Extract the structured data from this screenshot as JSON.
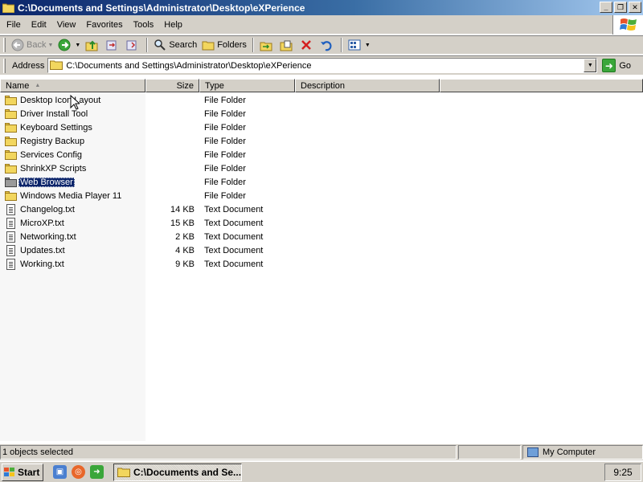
{
  "window": {
    "title": "C:\\Documents and Settings\\Administrator\\Desktop\\eXPerience",
    "minimize_glyph": "_",
    "maximize_glyph": "❐",
    "close_glyph": "✕"
  },
  "menu": {
    "items": [
      {
        "label": "File"
      },
      {
        "label": "Edit"
      },
      {
        "label": "View"
      },
      {
        "label": "Favorites"
      },
      {
        "label": "Tools"
      },
      {
        "label": "Help"
      }
    ]
  },
  "toolbar": {
    "back_label": "Back",
    "search_label": "Search",
    "folders_label": "Folders"
  },
  "address": {
    "label": "Address",
    "value": "C:\\Documents and Settings\\Administrator\\Desktop\\eXPerience",
    "go_label": "Go"
  },
  "columns": {
    "name": "Name",
    "size": "Size",
    "type": "Type",
    "description": "Description"
  },
  "files": [
    {
      "name": "Desktop Icon Layout",
      "size": "",
      "type": "File Folder",
      "kind": "folder",
      "selected": false
    },
    {
      "name": "Driver Install Tool",
      "size": "",
      "type": "File Folder",
      "kind": "folder",
      "selected": false
    },
    {
      "name": "Keyboard Settings",
      "size": "",
      "type": "File Folder",
      "kind": "folder",
      "selected": false
    },
    {
      "name": "Registry Backup",
      "size": "",
      "type": "File Folder",
      "kind": "folder",
      "selected": false
    },
    {
      "name": "Services Config",
      "size": "",
      "type": "File Folder",
      "kind": "folder",
      "selected": false
    },
    {
      "name": "ShrinkXP Scripts",
      "size": "",
      "type": "File Folder",
      "kind": "folder",
      "selected": false
    },
    {
      "name": "Web Browser",
      "size": "",
      "type": "File Folder",
      "kind": "folder",
      "selected": true
    },
    {
      "name": "Windows Media Player 11",
      "size": "",
      "type": "File Folder",
      "kind": "folder",
      "selected": false
    },
    {
      "name": "Changelog.txt",
      "size": "14 KB",
      "type": "Text Document",
      "kind": "text",
      "selected": false
    },
    {
      "name": "MicroXP.txt",
      "size": "15 KB",
      "type": "Text Document",
      "kind": "text",
      "selected": false
    },
    {
      "name": "Networking.txt",
      "size": "2 KB",
      "type": "Text Document",
      "kind": "text",
      "selected": false
    },
    {
      "name": "Updates.txt",
      "size": "4 KB",
      "type": "Text Document",
      "kind": "text",
      "selected": false
    },
    {
      "name": "Working.txt",
      "size": "9 KB",
      "type": "Text Document",
      "kind": "text",
      "selected": false
    }
  ],
  "status": {
    "selection": "1 objects selected",
    "location": "My Computer"
  },
  "taskbar": {
    "start_label": "Start",
    "task_label": "C:\\Documents and Se...",
    "clock": "9:25"
  },
  "colors": {
    "title_active": "#0a246a",
    "face": "#d4d0c8",
    "selection": "#0a246a"
  }
}
